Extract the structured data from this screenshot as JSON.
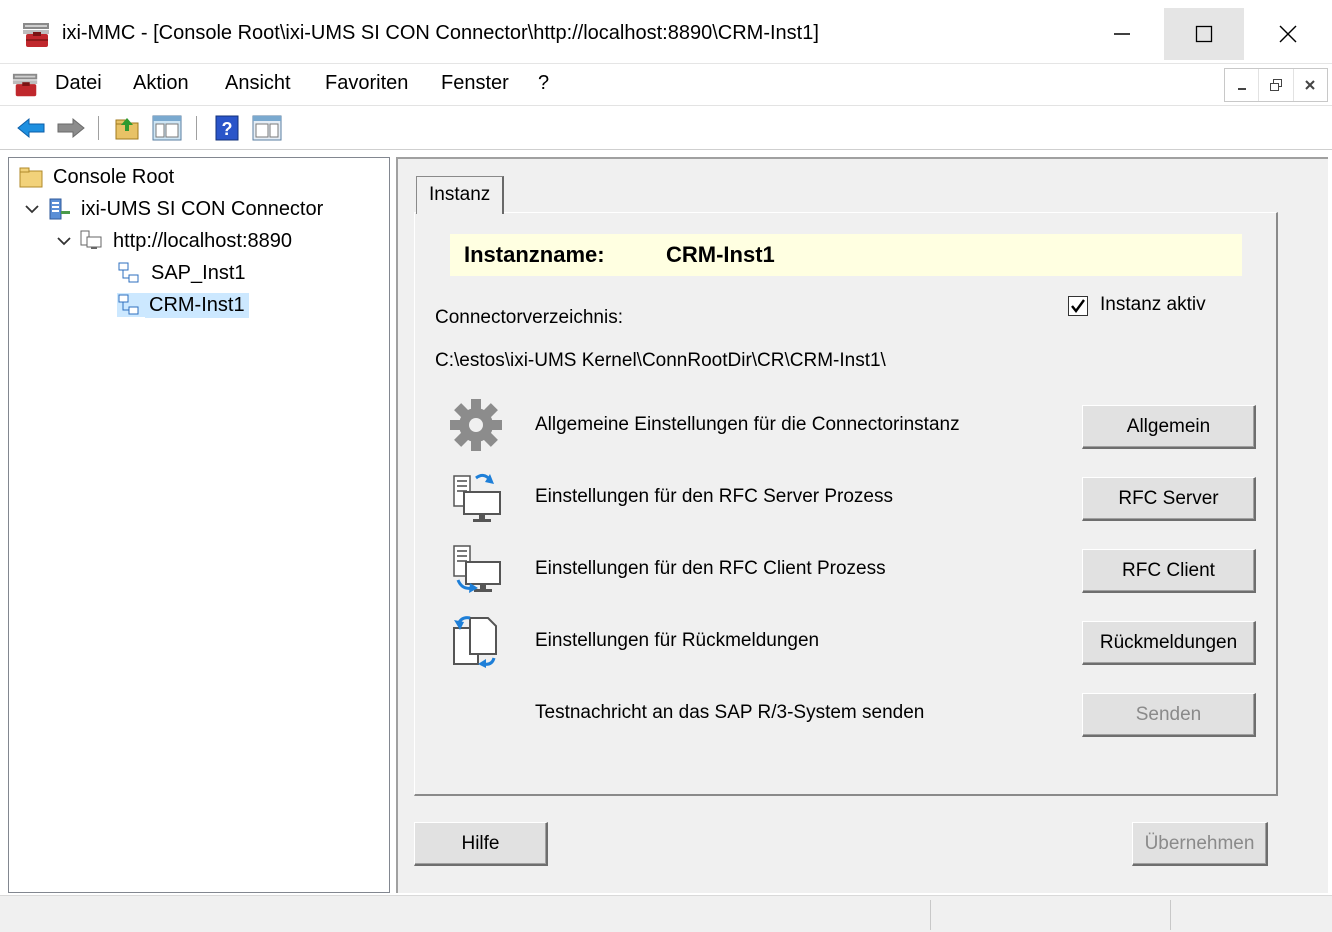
{
  "window": {
    "title": "ixi-MMC - [Console Root\\ixi-UMS SI CON Connector\\http://localhost:8890\\CRM-Inst1]"
  },
  "menu": {
    "items": [
      "Datei",
      "Aktion",
      "Ansicht",
      "Favoriten",
      "Fenster",
      "?"
    ]
  },
  "tree": {
    "root": "Console Root",
    "connector": "ixi-UMS SI CON Connector",
    "server": "http://localhost:8890",
    "instances": [
      "SAP_Inst1",
      "CRM-Inst1"
    ],
    "selected": "CRM-Inst1"
  },
  "panel": {
    "tab_label": "Instanz",
    "instance_label": "Instanzname:",
    "instance_name": "CRM-Inst1",
    "active_label": "Instanz aktiv",
    "active_checked": true,
    "dir_label": "Connectorverzeichnis:",
    "dir_path": "C:\\estos\\ixi-UMS Kernel\\ConnRootDir\\CR\\CRM-Inst1\\",
    "rows": [
      {
        "text": "Allgemeine Einstellungen für die Connectorinstanz",
        "button": "Allgemein",
        "icon": "gear-icon",
        "enabled": true
      },
      {
        "text": "Einstellungen für den RFC Server Prozess",
        "button": "RFC Server",
        "icon": "rfc-server-icon",
        "enabled": true
      },
      {
        "text": "Einstellungen für den RFC Client Prozess",
        "button": "RFC Client",
        "icon": "rfc-client-icon",
        "enabled": true
      },
      {
        "text": "Einstellungen für Rückmeldungen",
        "button": "Rückmeldungen",
        "icon": "feedback-icon",
        "enabled": true
      },
      {
        "text": "Testnachricht an das SAP R/3-System senden",
        "button": "Senden",
        "icon": "",
        "enabled": false
      }
    ],
    "help_button": "Hilfe",
    "apply_button": "Übernehmen",
    "apply_enabled": false
  },
  "colors": {
    "selection": "#cce8ff",
    "header_bg": "#ffffe1",
    "dialog_bg": "#f0f0f0"
  }
}
